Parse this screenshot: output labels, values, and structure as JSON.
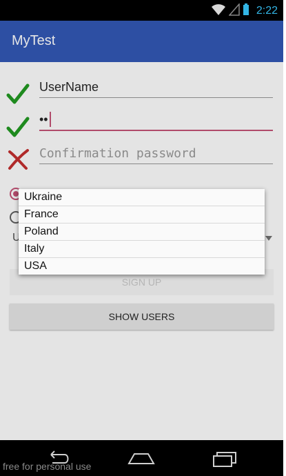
{
  "status_bar": {
    "time": "2:22"
  },
  "app_bar": {
    "title": "MyTest"
  },
  "form": {
    "username": {
      "value": "UserName"
    },
    "password": {
      "value": "••"
    },
    "confirm_password": {
      "placeholder": "Confirmation password"
    },
    "spinner": {
      "selected_initial": "U"
    }
  },
  "dropdown": {
    "options": [
      "Ukraine",
      "France",
      "Poland",
      "Italy",
      "USA"
    ]
  },
  "buttons": {
    "sign_up": "SIGN UP",
    "show_users": "SHOW USERS"
  },
  "watermark": "free for personal use",
  "colors": {
    "app_bar": "#2d4fa3",
    "status_accent": "#33b5e5",
    "focus": "#b04a6a",
    "check": "#1e8a1e",
    "cross": "#b02a2a"
  }
}
